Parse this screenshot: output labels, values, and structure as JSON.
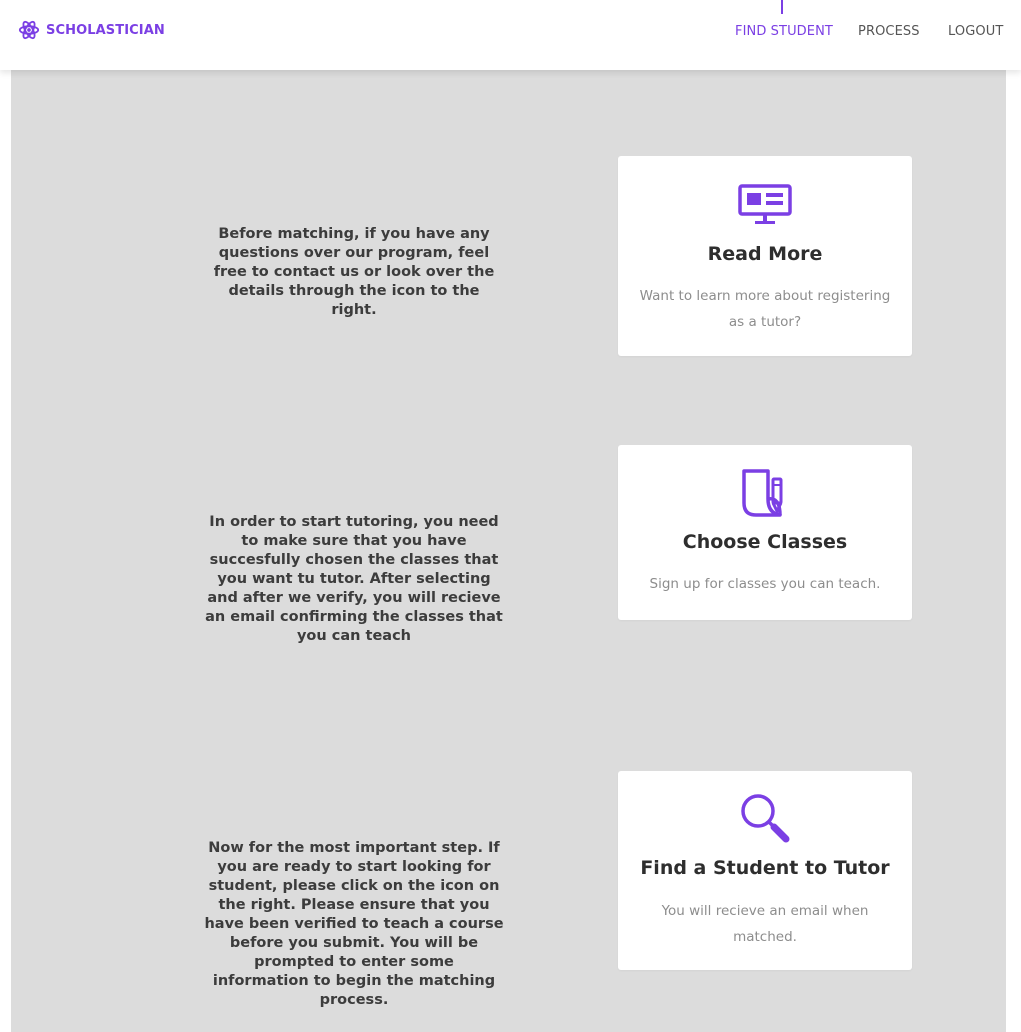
{
  "nav": {
    "brand": "SCHOLASTICIAN",
    "links": [
      "FIND STUDENT",
      "PROCESS",
      "LOGOUT"
    ],
    "active": "FIND STUDENT"
  },
  "colors": {
    "accent": "#7b3fe4",
    "panel": "#dcdcdc",
    "card": "#ffffff"
  },
  "steps": [
    {
      "text": "Before matching, if you have any questions over our program, feel free to contact us or look over the details through the icon to the right.",
      "card": {
        "icon": "monitor-icon",
        "title": "Read More",
        "description": "Want to learn more about registering as a tutor?"
      }
    },
    {
      "text": "In order to start tutoring, you need to make sure that you have succesfully chosen the classes that you want tu tutor. After selecting and after we verify, you will recieve an email confirming the classes that you can teach",
      "card": {
        "icon": "document-pencil-icon",
        "title": "Choose Classes",
        "description": "Sign up for classes you can teach."
      }
    },
    {
      "text": "Now for the most important step. If you are ready to start looking for student, please click on the icon on the right. Please ensure that you have been verified to teach a course before you submit. You will be prompted to enter some information to begin the matching process.",
      "card": {
        "icon": "search-icon",
        "title": "Find a Student to Tutor",
        "description": "You will recieve an email when matched."
      }
    }
  ]
}
